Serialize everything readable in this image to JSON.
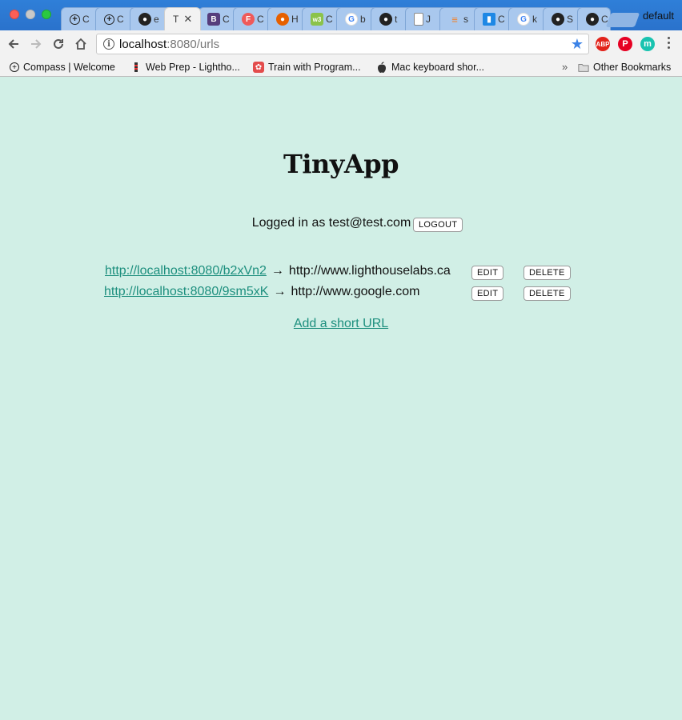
{
  "browser": {
    "tabs": [
      {
        "title": "C",
        "icon": "compass-icon"
      },
      {
        "title": "C",
        "icon": "compass-icon"
      },
      {
        "title": "e",
        "icon": "github-icon"
      },
      {
        "title": "T",
        "icon": "page-icon",
        "active": true
      },
      {
        "title": "C",
        "icon": "bootstrap-icon"
      },
      {
        "title": "C",
        "icon": "flatiron-icon"
      },
      {
        "title": "H",
        "icon": "firefox-icon"
      },
      {
        "title": "C",
        "icon": "w3schools-icon"
      },
      {
        "title": "b",
        "icon": "google-icon"
      },
      {
        "title": "t",
        "icon": "github-icon"
      },
      {
        "title": "J",
        "icon": "document-icon"
      },
      {
        "title": "s",
        "icon": "stackoverflow-icon"
      },
      {
        "title": "C",
        "icon": "chart-icon"
      },
      {
        "title": "k",
        "icon": "google-icon"
      },
      {
        "title": "S",
        "icon": "github-icon"
      },
      {
        "title": "C",
        "icon": "github-icon"
      }
    ],
    "profile_name": "default",
    "url_host": "localhost",
    "url_rest": ":8080/urls",
    "bookmarks": [
      {
        "label": "Compass | Welcome",
        "icon": "compass-icon"
      },
      {
        "label": "Web Prep - Lightho...",
        "icon": "lighthouse-icon"
      },
      {
        "label": "Train with Program...",
        "icon": "codewars-icon"
      },
      {
        "label": "Mac keyboard shor...",
        "icon": "apple-icon"
      }
    ],
    "more_bookmarks": "»",
    "other_bookmarks": "Other Bookmarks",
    "extensions": [
      {
        "name": "adblock-plus-icon",
        "label": "ABP",
        "color": "#e2231a"
      },
      {
        "name": "pinterest-icon",
        "label": "P",
        "color": "#e60023"
      },
      {
        "name": "momentum-icon",
        "label": "m",
        "color": "#19c3b0"
      }
    ]
  },
  "page": {
    "title": "TinyApp",
    "logged_in_text": "Logged in as test@test.com",
    "logout_label": "LOGOUT",
    "urls": [
      {
        "short": "http://localhost:8080/b2xVn2",
        "long": "http://www.lighthouselabs.ca",
        "edit": "EDIT",
        "delete": "DELETE"
      },
      {
        "short": "http://localhost:8080/9sm5xK",
        "long": "http://www.google.com",
        "edit": "EDIT",
        "delete": "DELETE"
      }
    ],
    "arrow": "→",
    "add_link": "Add a short URL"
  },
  "colors": {
    "page_background": "#d1efe6",
    "link": "#1d8f7e",
    "tabstrip": "#2f7fd8"
  }
}
